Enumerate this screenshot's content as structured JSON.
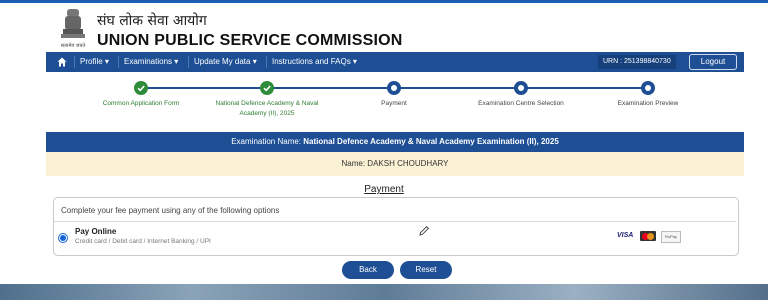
{
  "header": {
    "title_hindi": "संघ लोक सेवा आयोग",
    "title_english": "UNION PUBLIC SERVICE COMMISSION",
    "emblem_caption": "सत्यमेव जयते"
  },
  "nav": {
    "items": [
      {
        "label": "Profile ▾"
      },
      {
        "label": "Examinations ▾"
      },
      {
        "label": "Update My data ▾"
      },
      {
        "label": "Instructions and FAQs ▾"
      }
    ],
    "urn": "URN : 251398840730",
    "logout_label": "Logout"
  },
  "stepper": {
    "steps": [
      {
        "label": "Common Application Form",
        "status": "done"
      },
      {
        "label": "National Defence Academy & Naval Academy (II), 2025",
        "status": "done"
      },
      {
        "label": "Payment",
        "status": "current"
      },
      {
        "label": "Examination Centre Selection",
        "status": "pending"
      },
      {
        "label": "Examination Preview",
        "status": "pending"
      }
    ]
  },
  "exam": {
    "label": "Examination Name:",
    "name": "National Defence Academy & Naval Academy Examination (II), 2025"
  },
  "candidate": {
    "label": "Name:",
    "name": "DAKSH CHOUDHARY"
  },
  "payment": {
    "heading": "Payment",
    "instruction": "Complete your fee payment using any of the following options",
    "option": {
      "title": "Pay Online",
      "subtitle": "Credit card / Debit card / Internet Banking / UPI",
      "selected": true
    },
    "card_brands": [
      "VISA",
      "mastercard",
      "RuPay"
    ]
  },
  "actions": {
    "back_label": "Back",
    "reset_label": "Reset"
  },
  "colors": {
    "nav_blue": "#1e4f95",
    "done_green": "#2e8b3a",
    "name_bar": "#fbf2d5"
  }
}
